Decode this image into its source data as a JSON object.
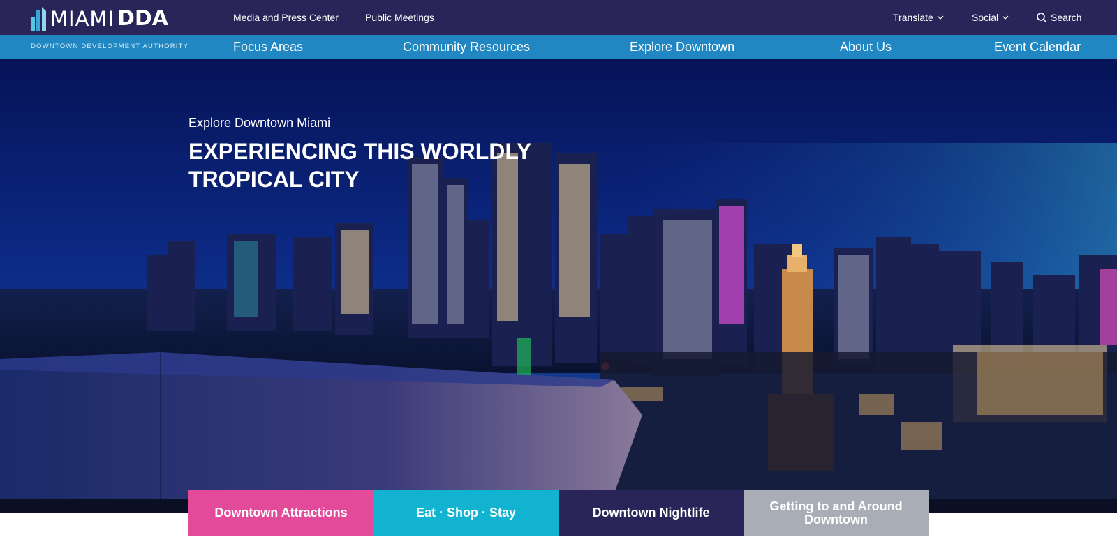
{
  "brand": {
    "logo_thin": "MIAMI",
    "logo_bold": "DDA",
    "tagline": "DOWNTOWN DEVELOPMENT AUTHORITY"
  },
  "utility_nav": {
    "media": "Media and Press Center",
    "meetings": "Public Meetings",
    "translate": "Translate",
    "social": "Social",
    "search": "Search"
  },
  "main_nav": [
    "Focus Areas",
    "Community Resources",
    "Explore Downtown",
    "About Us",
    "Event Calendar"
  ],
  "hero": {
    "kicker": "Explore Downtown Miami",
    "title": "EXPERIENCING THIS WORLDLY TROPICAL CITY"
  },
  "tiles": [
    {
      "label": "Downtown Attractions",
      "color": "#e34b9a"
    },
    {
      "label": "Eat · Shop · Stay",
      "color": "#12b3d1"
    },
    {
      "label": "Downtown Nightlife",
      "color": "#2a2558"
    },
    {
      "label": "Getting to and Around Downtown",
      "color": "#a9aeb6"
    }
  ],
  "colors": {
    "header_bg": "#2a2558",
    "nav_bg": "#2087c2"
  },
  "icons": {
    "logo": "skyline-bars-icon",
    "dropdown": "chevron-down-icon",
    "search": "magnifier-icon"
  }
}
